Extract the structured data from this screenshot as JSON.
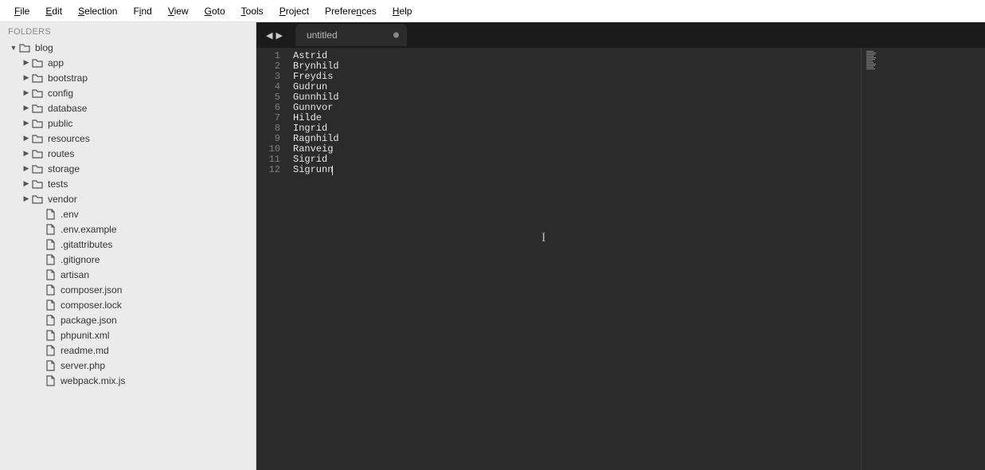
{
  "menu": {
    "items": [
      {
        "label": "File",
        "ul": "F"
      },
      {
        "label": "Edit",
        "ul": "E"
      },
      {
        "label": "Selection",
        "ul": "S"
      },
      {
        "label": "Find",
        "ul": "i",
        "pre": "F"
      },
      {
        "label": "View",
        "ul": "V"
      },
      {
        "label": "Goto",
        "ul": "G"
      },
      {
        "label": "Tools",
        "ul": "T"
      },
      {
        "label": "Project",
        "ul": "P"
      },
      {
        "label": "Preferences",
        "ul": "n",
        "pre": "Prefere"
      },
      {
        "label": "Help",
        "ul": "H"
      }
    ]
  },
  "sidebar": {
    "header": "FOLDERS",
    "tree": [
      {
        "depth": 0,
        "disclosure": "down",
        "icon": "folder",
        "label": "blog"
      },
      {
        "depth": 1,
        "disclosure": "right",
        "icon": "folder",
        "label": "app"
      },
      {
        "depth": 1,
        "disclosure": "right",
        "icon": "folder",
        "label": "bootstrap"
      },
      {
        "depth": 1,
        "disclosure": "right",
        "icon": "folder",
        "label": "config"
      },
      {
        "depth": 1,
        "disclosure": "right",
        "icon": "folder",
        "label": "database"
      },
      {
        "depth": 1,
        "disclosure": "right",
        "icon": "folder",
        "label": "public"
      },
      {
        "depth": 1,
        "disclosure": "right",
        "icon": "folder",
        "label": "resources"
      },
      {
        "depth": 1,
        "disclosure": "right",
        "icon": "folder",
        "label": "routes"
      },
      {
        "depth": 1,
        "disclosure": "right",
        "icon": "folder",
        "label": "storage"
      },
      {
        "depth": 1,
        "disclosure": "right",
        "icon": "folder",
        "label": "tests"
      },
      {
        "depth": 1,
        "disclosure": "right",
        "icon": "folder",
        "label": "vendor"
      },
      {
        "depth": 2,
        "disclosure": "",
        "icon": "file",
        "label": ".env"
      },
      {
        "depth": 2,
        "disclosure": "",
        "icon": "file",
        "label": ".env.example"
      },
      {
        "depth": 2,
        "disclosure": "",
        "icon": "file",
        "label": ".gitattributes"
      },
      {
        "depth": 2,
        "disclosure": "",
        "icon": "file",
        "label": ".gitignore"
      },
      {
        "depth": 2,
        "disclosure": "",
        "icon": "file",
        "label": "artisan"
      },
      {
        "depth": 2,
        "disclosure": "",
        "icon": "file",
        "label": "composer.json"
      },
      {
        "depth": 2,
        "disclosure": "",
        "icon": "file",
        "label": "composer.lock"
      },
      {
        "depth": 2,
        "disclosure": "",
        "icon": "file",
        "label": "package.json"
      },
      {
        "depth": 2,
        "disclosure": "",
        "icon": "file",
        "label": "phpunit.xml"
      },
      {
        "depth": 2,
        "disclosure": "",
        "icon": "file",
        "label": "readme.md"
      },
      {
        "depth": 2,
        "disclosure": "",
        "icon": "file",
        "label": "server.php"
      },
      {
        "depth": 2,
        "disclosure": "",
        "icon": "file",
        "label": "webpack.mix.js"
      }
    ]
  },
  "tabs": {
    "active": {
      "title": "untitled",
      "dirty": true
    }
  },
  "editor": {
    "lines": [
      "Astrid",
      "Brynhild",
      "Freydis",
      "Gudrun",
      "Gunnhild",
      "Gunnvor",
      "Hilde",
      "Ingrid",
      "Ragnhild",
      "Ranveig",
      "Sigrid",
      "Sigrunn"
    ],
    "cursor_line": 12
  }
}
